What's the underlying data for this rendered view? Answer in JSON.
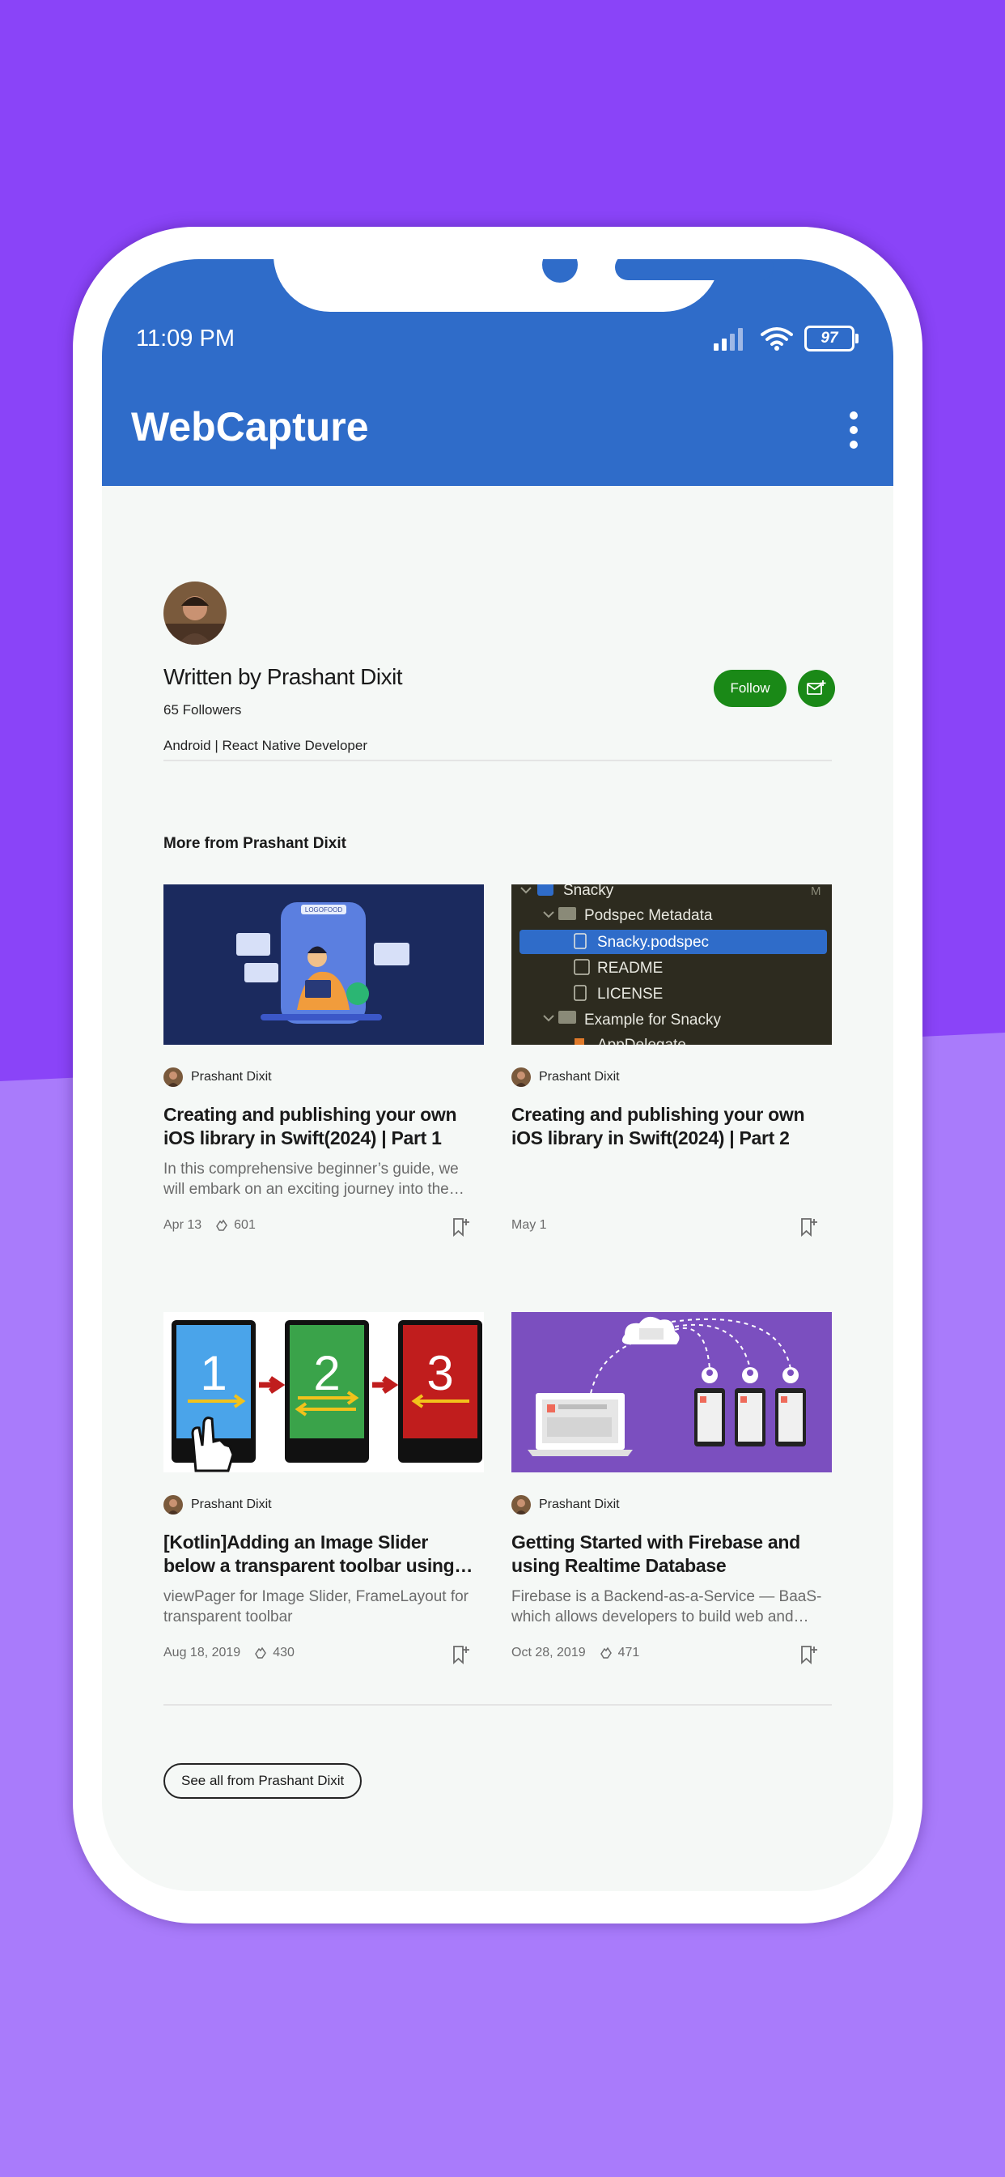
{
  "status_bar": {
    "time": "11:09 PM",
    "battery": "97"
  },
  "app_bar": {
    "title": "WebCapture"
  },
  "author": {
    "title": "Written by Prashant Dixit",
    "followers": "65 Followers",
    "bio": "Android | React Native Developer",
    "follow_label": "Follow"
  },
  "more_heading": "More from Prashant Dixit",
  "articles": [
    {
      "author": "Prashant Dixit",
      "title": "Creating and publishing your own iOS library in Swift(2024) | Part 1",
      "subtitle": "In this comprehensive beginner’s guide, we will embark on an exciting journey into the…",
      "date": "Apr 13",
      "claps": "601",
      "thumb_text": "LOGOFOOD"
    },
    {
      "author": "Prashant Dixit",
      "title": "Creating and publishing your own iOS library in Swift(2024) | Part 2",
      "subtitle": "",
      "date": "May 1",
      "claps": "",
      "thumb_tree": [
        "Snacky",
        "Podspec Metadata",
        "Snacky.podspec",
        "README",
        "LICENSE",
        "Example for Snacky",
        "AppDelegate"
      ],
      "thumb_badge": "M"
    },
    {
      "author": "Prashant Dixit",
      "title": "[Kotlin]Adding an Image Slider below a transparent toolbar using…",
      "subtitle": "viewPager for Image Slider, FrameLayout for transparent toolbar",
      "date": "Aug 18, 2019",
      "claps": "430",
      "thumb_numbers": [
        "1",
        "2",
        "3"
      ]
    },
    {
      "author": "Prashant Dixit",
      "title": "Getting Started with Firebase and using Realtime Database",
      "subtitle": "Firebase is a Backend-as-a-Service — BaaS- which allows developers to build web and…",
      "date": "Oct 28, 2019",
      "claps": "471"
    }
  ],
  "see_all_label": "See all from Prashant Dixit",
  "colors": {
    "app_bar": "#2f6cc9",
    "follow_green": "#1a8917",
    "background_purple": "#8a44f8",
    "background_light_purple": "#a97bfb"
  }
}
